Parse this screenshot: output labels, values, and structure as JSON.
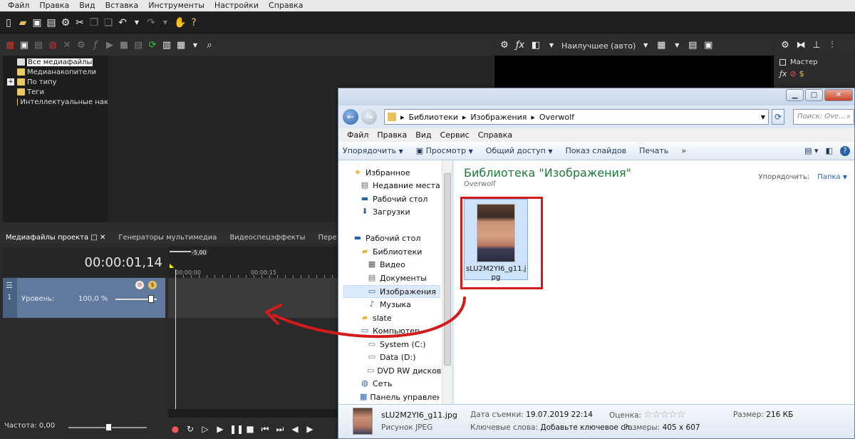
{
  "vegas": {
    "menu": [
      "Файл",
      "Правка",
      "Вид",
      "Вставка",
      "Инструменты",
      "Настройки",
      "Справка"
    ],
    "tree": [
      "Все медиафайлы",
      "Медианакопители",
      "По типу",
      "Теги",
      "Интеллектуальные нак"
    ],
    "tabs": [
      "Медиафайлы проекта",
      "Генераторы мультимедиа",
      "Видеоспецэффекты",
      "Пере"
    ],
    "preview_quality": "Наилучшее (авто)",
    "master_label": "Мастер",
    "timecode": "00:00:01,14",
    "ruler_marker": "-5,00",
    "ruler_ticks": [
      "00:00:00",
      "00:00:15"
    ],
    "track_level_label": "Уровень:",
    "track_level_value": "100,0 %",
    "rate_label": "Частота: 0,00"
  },
  "explorer": {
    "breadcrumb": [
      "Библиотеки",
      "Изображения",
      "Overwolf"
    ],
    "search_placeholder": "Поиск: Ove...",
    "menu": [
      "Файл",
      "Правка",
      "Вид",
      "Сервис",
      "Справка"
    ],
    "commands": [
      "Упорядочить",
      "Просмотр",
      "Общий доступ",
      "Показ слайдов",
      "Печать"
    ],
    "more": "»",
    "nav": {
      "favorites": "Избранное",
      "recent": "Недавние места",
      "desktop_fav": "Рабочий стол",
      "downloads": "Загрузки",
      "desktop": "Рабочий стол",
      "libraries": "Библиотеки",
      "video": "Видео",
      "documents": "Документы",
      "images": "Изображения",
      "music": "Музыка",
      "slate": "slate",
      "computer": "Компьютер",
      "system": "System (C:)",
      "data": "Data (D:)",
      "dvd": "DVD RW дисковод",
      "network": "Сеть",
      "control_panel": "Панель управления"
    },
    "library_title": "Библиотека \"Изображения\"",
    "library_subtitle": "Overwolf",
    "arrange_label": "Упорядочить:",
    "arrange_value": "Папка",
    "file_name": "sLU2M2YI6_g11.jpg",
    "file_name_thumb": "sLU2M2YI6_g11.j\npg",
    "details": {
      "filename": "sLU2M2YI6_g11.jpg",
      "type": "Рисунок JPEG",
      "date_label": "Дата съемки:",
      "date_value": "19.07.2019 22:14",
      "keywords_label": "Ключевые слова:",
      "keywords_value": "Добавьте ключевое сл...",
      "rating_label": "Оценка:",
      "size_label": "Размер:",
      "size_value": "216 КБ",
      "dims_label": "Размеры:",
      "dims_value": "405 x 607"
    }
  },
  "colors": {
    "annotation_red": "#d21b1b",
    "library_green": "#1e7a3a"
  }
}
